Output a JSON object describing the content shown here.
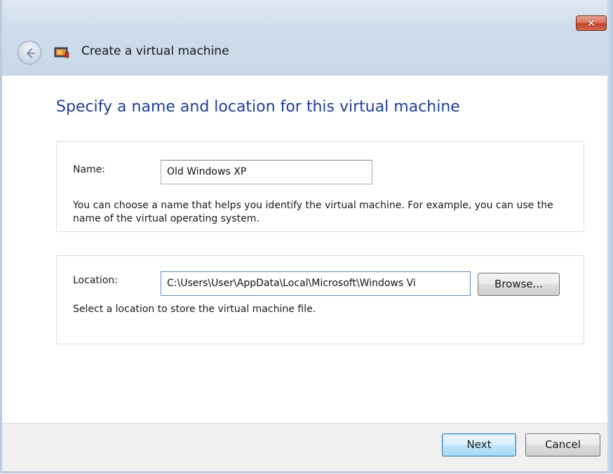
{
  "window": {
    "title": "Create a virtual machine",
    "close_label": "✕"
  },
  "page": {
    "heading": "Specify a name and location for this virtual machine"
  },
  "name_section": {
    "label": "Name:",
    "value": "Old Windows XP",
    "help": "You can choose a name that helps you identify the virtual machine. For example, you can use the name of the virtual operating system."
  },
  "location_section": {
    "label": "Location:",
    "value": "C:\\Users\\User\\AppData\\Local\\Microsoft\\Windows Vi",
    "browse_label": "Browse...",
    "help": "Select a location to store the virtual machine file."
  },
  "footer": {
    "next_label": "Next",
    "cancel_label": "Cancel"
  },
  "icons": {
    "back": "back-arrow-icon",
    "app": "virtual-machine-icon",
    "close": "close-icon"
  },
  "colors": {
    "heading": "#1e3f9a",
    "close_button": "#c4422a",
    "default_button_border": "#3c7fb1"
  }
}
